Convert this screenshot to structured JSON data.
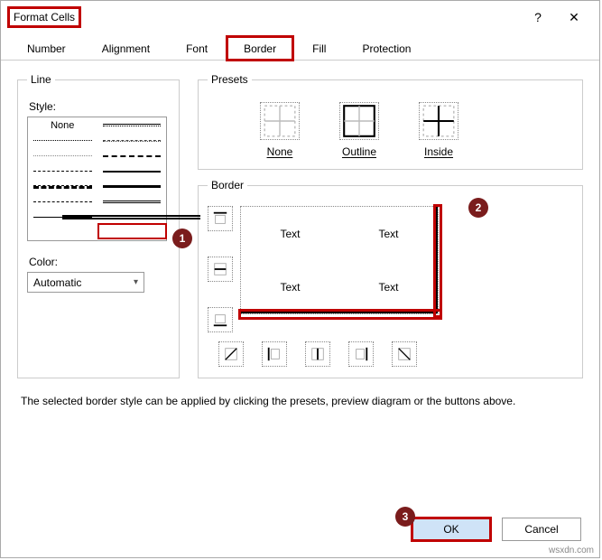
{
  "title": "Format Cells",
  "help_symbol": "?",
  "close_symbol": "✕",
  "tabs": {
    "number": "Number",
    "alignment": "Alignment",
    "font": "Font",
    "border": "Border",
    "fill": "Fill",
    "protection": "Protection"
  },
  "line": {
    "legend": "Line",
    "style_label": "Style:",
    "none_label": "None",
    "color_label": "Color:",
    "color_value": "Automatic"
  },
  "presets": {
    "legend": "Presets",
    "none": "None",
    "outline": "Outline",
    "inside": "Inside"
  },
  "border": {
    "legend": "Border",
    "text": "Text"
  },
  "description": "The selected border style can be applied by clicking the presets, preview diagram or the buttons above.",
  "buttons": {
    "ok": "OK",
    "cancel": "Cancel"
  },
  "callouts": {
    "c1": "1",
    "c2": "2",
    "c3": "3"
  },
  "watermark": "wsxdn.com"
}
